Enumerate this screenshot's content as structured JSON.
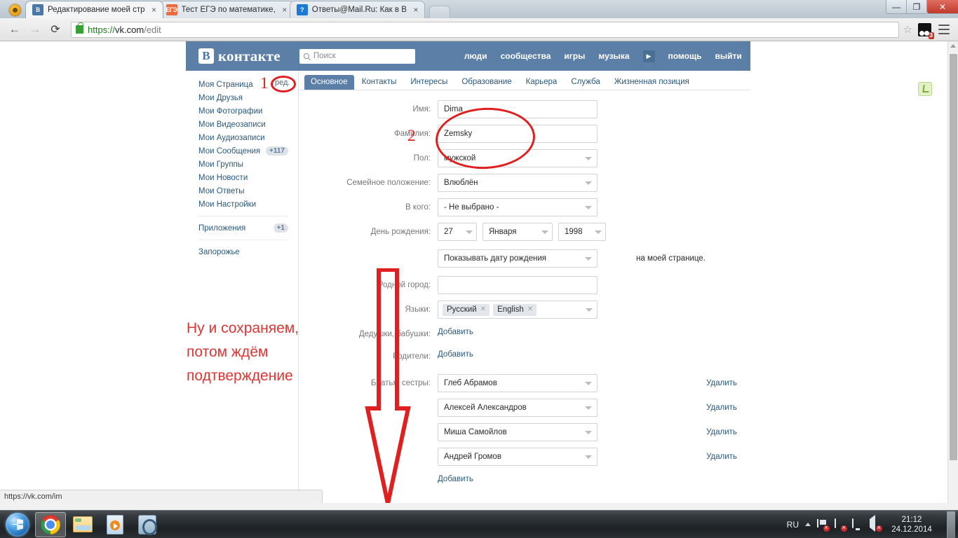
{
  "browser": {
    "tabs": [
      {
        "title": "Редактирование моей стр",
        "favicon": "vk-icon",
        "active": true
      },
      {
        "title": "Тест ЕГЭ по математике,",
        "favicon": "ege-icon",
        "active": false
      },
      {
        "title": "Ответы@Mail.Ru: Как в В",
        "favicon": "mail-icon",
        "active": false
      }
    ],
    "close_label": "×",
    "window_controls": {
      "minimize": "—",
      "maximize": "❐",
      "close": "✕"
    },
    "nav": {
      "back": "←",
      "forward": "→",
      "reload": "⟳"
    },
    "url": {
      "scheme": "https://",
      "host": "vk.com",
      "path": "/edit"
    },
    "star": "☆",
    "extension_badge": "3",
    "status_bar": "https://vk.com/im"
  },
  "vk": {
    "logo": {
      "mark": "B",
      "text": "контакте"
    },
    "search_placeholder": "Поиск",
    "nav": [
      "люди",
      "сообщества",
      "игры",
      "музыка"
    ],
    "nav_play": "▶",
    "nav_right": [
      "помощь",
      "выйти"
    ],
    "sidebar": [
      {
        "label": "Моя Страница",
        "badge": ""
      },
      {
        "label": "Мои Друзья",
        "badge": ""
      },
      {
        "label": "Мои Фотографии",
        "badge": ""
      },
      {
        "label": "Мои Видеозаписи",
        "badge": ""
      },
      {
        "label": "Мои Аудиозаписи",
        "badge": ""
      },
      {
        "label": "Мои Сообщения",
        "badge": "+117"
      },
      {
        "label": "Мои Группы",
        "badge": ""
      },
      {
        "label": "Мои Новости",
        "badge": ""
      },
      {
        "label": "Мои Ответы",
        "badge": ""
      },
      {
        "label": "Мои Настройки",
        "badge": ""
      }
    ],
    "sidebar_apps": {
      "label": "Приложения",
      "badge": "+1"
    },
    "sidebar_city": {
      "label": "Запорожье"
    },
    "edit_link": "ред.",
    "tabs": [
      {
        "label": "Основное",
        "active": true
      },
      {
        "label": "Контакты",
        "active": false
      },
      {
        "label": "Интересы",
        "active": false
      },
      {
        "label": "Образование",
        "active": false
      },
      {
        "label": "Карьера",
        "active": false
      },
      {
        "label": "Служба",
        "active": false
      },
      {
        "label": "Жизненная позиция",
        "active": false
      }
    ],
    "form": {
      "first_name": {
        "label": "Имя:",
        "value": "Dima"
      },
      "last_name": {
        "label": "Фамилия:",
        "value": "Zemsky"
      },
      "gender": {
        "label": "Пол:",
        "value": "мужской"
      },
      "marital": {
        "label": "Семейное положение:",
        "value": "Влюблён"
      },
      "in_whom": {
        "label": "В кого:",
        "value": "- Не выбрано -"
      },
      "birthday": {
        "label": "День рождения:",
        "day": "27",
        "month": "Января",
        "year": "1998"
      },
      "birthday_visibility": {
        "value": "Показывать дату рождения",
        "suffix": "на моей странице."
      },
      "hometown": {
        "label": "Родной город:",
        "value": ""
      },
      "languages": {
        "label": "Языки:",
        "chips": [
          "Русский",
          "English"
        ],
        "chip_remove": "✕"
      },
      "grandparents": {
        "label": "Дедушки, бабушки:",
        "add": "Добавить"
      },
      "parents": {
        "label": "Родители:",
        "add": "Добавить"
      },
      "siblings": {
        "label": "Братья, сестры:",
        "items": [
          {
            "name": "Глеб Абрамов",
            "delete": "Удалить"
          },
          {
            "name": "Алексей Александров",
            "delete": "Удалить"
          },
          {
            "name": "Миша Самойлов",
            "delete": "Удалить"
          },
          {
            "name": "Андрей Громов",
            "delete": "Удалить"
          }
        ],
        "add": "Добавить"
      }
    }
  },
  "annotations": {
    "step1": "1",
    "step2": "2",
    "note_line1": "Ну и сохраняем,",
    "note_line2": "потом ждём",
    "note_line3": "подтверждение",
    "color": "#e02020"
  },
  "taskbar": {
    "start": "start-orb",
    "items": [
      "chrome-icon",
      "explorer-icon",
      "media-player-icon",
      "kmplayer-icon"
    ],
    "language": "RU",
    "time": "21:12",
    "date": "24.12.2014"
  }
}
